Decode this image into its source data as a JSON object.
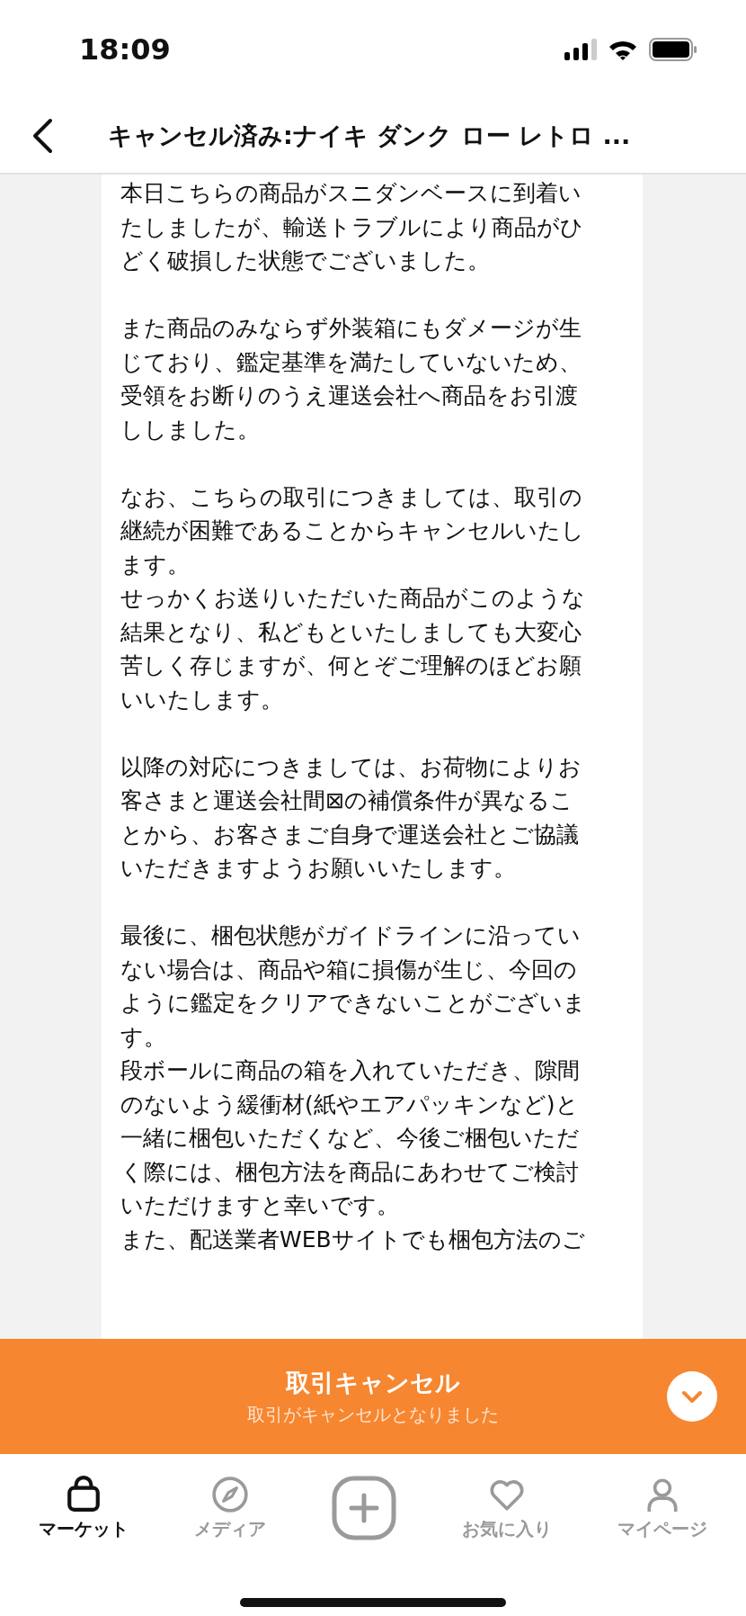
{
  "status_bar": {
    "time": "18:09"
  },
  "header": {
    "title": "キャンセル済み:ナイキ ダンク ロー レトロ ..."
  },
  "message": {
    "sections": [
      [
        {
          "lines": [
            "本日こちらの商品がスニダンベースに到着い",
            "たしましたが、輸送トラブルにより商品がひ",
            "どく破損した状態でございました。"
          ]
        }
      ],
      [
        {
          "lines": [
            "また商品のみならず外装箱にもダメージが生",
            "じており、鑑定基準を満たしていないため、",
            "受領をお断りのうえ運送会社へ商品をお引渡",
            "ししました。"
          ]
        }
      ],
      [
        {
          "lines": [
            "なお、こちらの取引につきましては、取引の",
            "継続が困難であることからキャンセルいたし",
            "ます。"
          ]
        },
        {
          "lines": [
            "せっかくお送りいただいた商品がこのような",
            "結果となり、私どもといたしましても大変心",
            "苦しく存じますが、何とぞご理解のほどお願",
            "いいたします。"
          ]
        }
      ],
      [
        {
          "lines": [
            "以降の対応につきましては、お荷物によりお",
            "客さまと運送会社間⊠の補償条件が異なるこ",
            "とから、お客さまご自身で運送会社とご協議",
            "いただきますようお願いいたします。"
          ]
        }
      ],
      [
        {
          "lines": [
            "最後に、梱包状態がガイドラインに沿ってい",
            "ない場合は、商品や箱に損傷が生じ、今回の",
            "ように鑑定をクリアできないことがございま",
            "す。"
          ]
        },
        {
          "lines": [
            "段ボールに商品の箱を入れていただき、隙間",
            "のないよう緩衝材(紙やエアパッキンなど)と",
            "一緒に梱包いただくなど、今後ご梱包いただ",
            "く際には、梱包方法を商品にあわせてご検討",
            "いただけますと幸いです。"
          ]
        },
        {
          "lines": [
            "また、配送業者WEBサイトでも梱包方法のご"
          ]
        }
      ]
    ]
  },
  "banner": {
    "title": "取引キャンセル",
    "subtitle": "取引がキャンセルとなりました"
  },
  "tab_bar": [
    {
      "kind": "bag",
      "label": "マーケット",
      "selected": true
    },
    {
      "kind": "compass",
      "label": "メディア",
      "selected": false
    },
    {
      "kind": "plus",
      "selected": false
    },
    {
      "kind": "heart",
      "label": "お気に入り",
      "selected": false
    },
    {
      "kind": "person",
      "label": "マイページ",
      "selected": false
    }
  ]
}
